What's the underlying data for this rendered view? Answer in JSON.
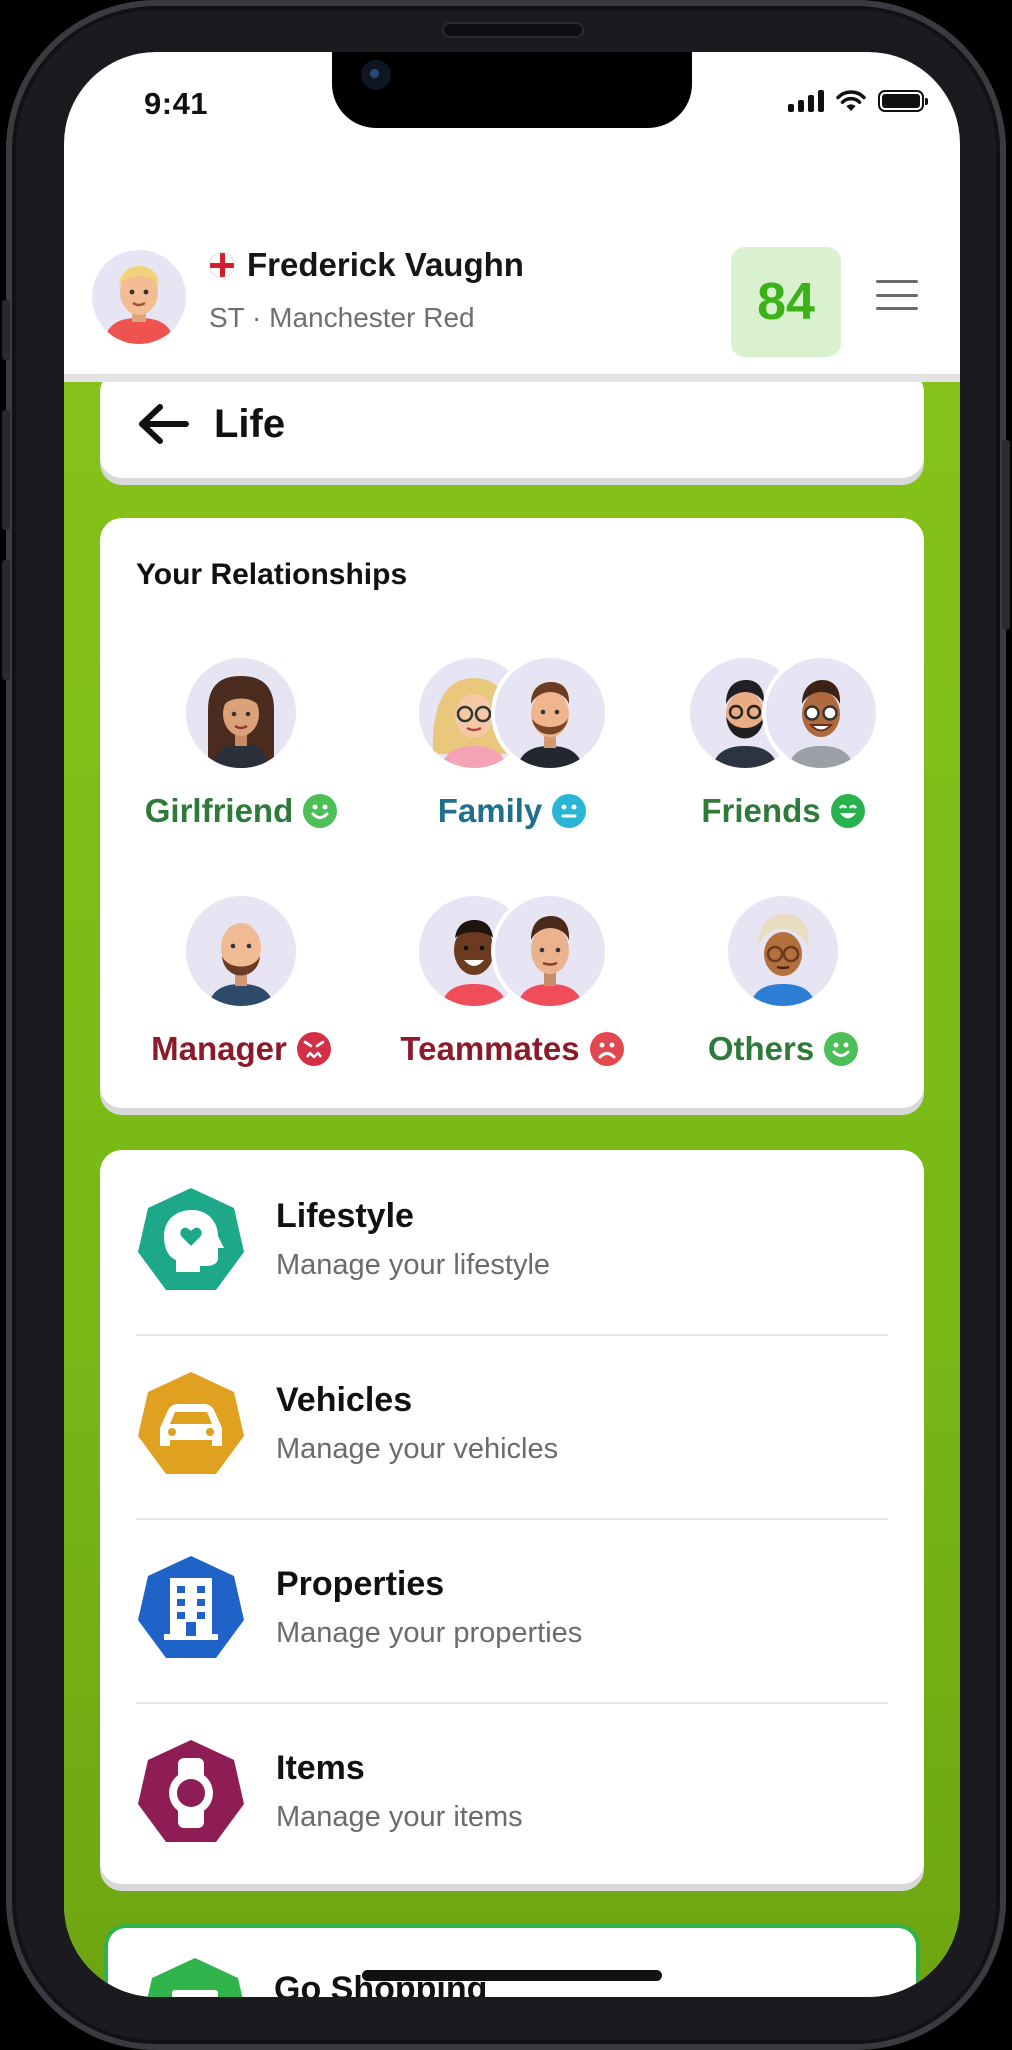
{
  "status_bar": {
    "time": "9:41"
  },
  "profile": {
    "name": "Frederick Vaughn",
    "subtitle": "ST · Manchester Red",
    "rating": "84"
  },
  "page": {
    "title": "Life"
  },
  "relationships": {
    "title": "Your Relationships",
    "items": [
      {
        "label": "Girlfriend",
        "mood": "happy",
        "color": "#2f7a3a"
      },
      {
        "label": "Family",
        "mood": "neutral",
        "color": "#207089"
      },
      {
        "label": "Friends",
        "mood": "very-happy",
        "color": "#2f7a3a"
      },
      {
        "label": "Manager",
        "mood": "angry",
        "color": "#8b1a2b"
      },
      {
        "label": "Teammates",
        "mood": "sad",
        "color": "#8b1a2b"
      },
      {
        "label": "Others",
        "mood": "happy",
        "color": "#2f7a3a"
      }
    ]
  },
  "menu_items": [
    {
      "title": "Lifestyle",
      "subtitle": "Manage your lifestyle",
      "icon": "head-heart-icon",
      "color": "#1ea88a"
    },
    {
      "title": "Vehicles",
      "subtitle": "Manage your vehicles",
      "icon": "car-icon",
      "color": "#e0a020"
    },
    {
      "title": "Properties",
      "subtitle": "Manage your properties",
      "icon": "building-icon",
      "color": "#1f63c9"
    },
    {
      "title": "Items",
      "subtitle": "Manage your items",
      "icon": "watch-icon",
      "color": "#8e1c55"
    }
  ],
  "shopping": {
    "title": "Go Shopping",
    "color": "#2fb34a"
  }
}
